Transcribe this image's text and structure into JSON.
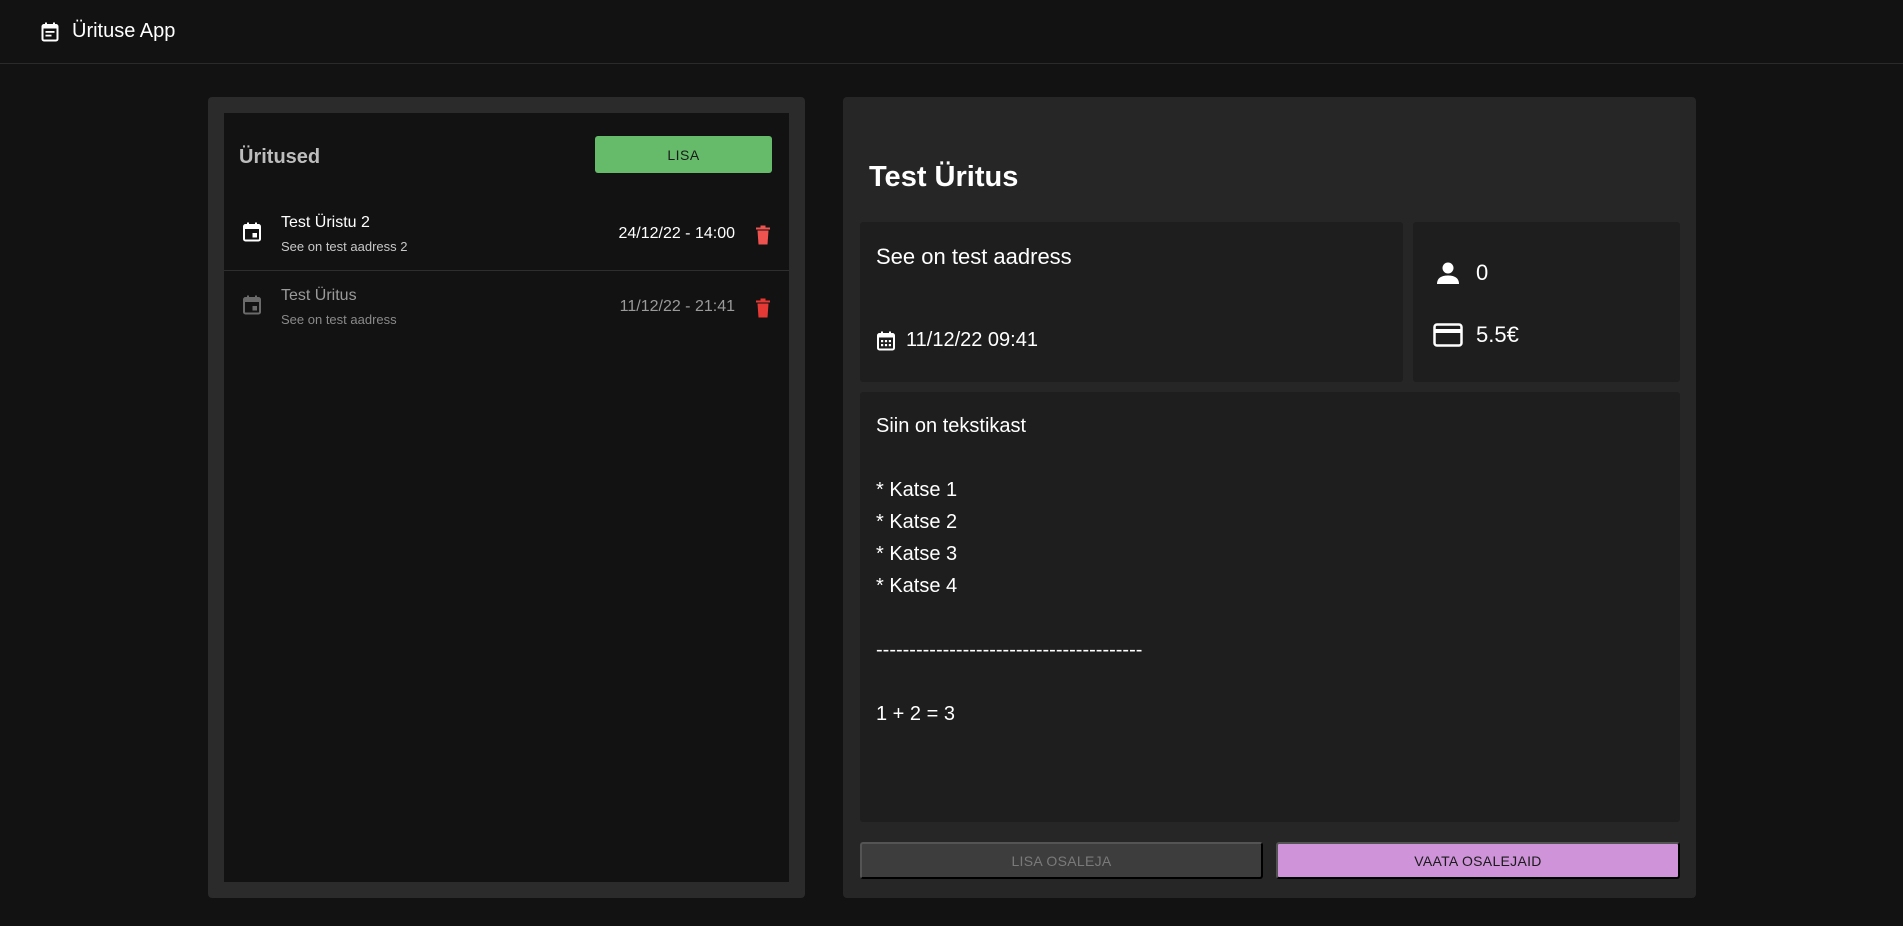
{
  "app": {
    "title": "Ürituse App",
    "logo_icon": "event-note-icon"
  },
  "colors": {
    "background": "#121212",
    "panel": "#2b2b2b",
    "add_button": "#66bb6a",
    "delete_icon": "#f44336",
    "view_button": "#ce93d8",
    "disabled_button": "#3d3d3d"
  },
  "event_list": {
    "title": "Üritused",
    "add_label": "LISA",
    "events": [
      {
        "name": "Test Üristu 2",
        "address": "See on test aadress 2",
        "datetime": "24/12/22 - 14:00",
        "icon": "event-icon",
        "delete_icon": "trash-icon"
      },
      {
        "name": "Test Üritus",
        "address": "See on test aadress",
        "datetime": "11/12/22 - 21:41",
        "icon": "event-icon",
        "delete_icon": "trash-icon"
      }
    ]
  },
  "detail": {
    "title": "Test Üritus",
    "address": "See on test aadress",
    "datetime": "11/12/22 09:41",
    "participants": "0",
    "price": "5.5€",
    "description_lines": [
      "Siin on tekstikast",
      "",
      "* Katse 1",
      "* Katse 2",
      "* Katse 3",
      "* Katse 4",
      "",
      "----------------------------------------",
      "",
      "1 + 2 = 3"
    ],
    "add_participant_label": "LISA OSALEJA",
    "view_participants_label": "VAATA OSALEJAID"
  }
}
